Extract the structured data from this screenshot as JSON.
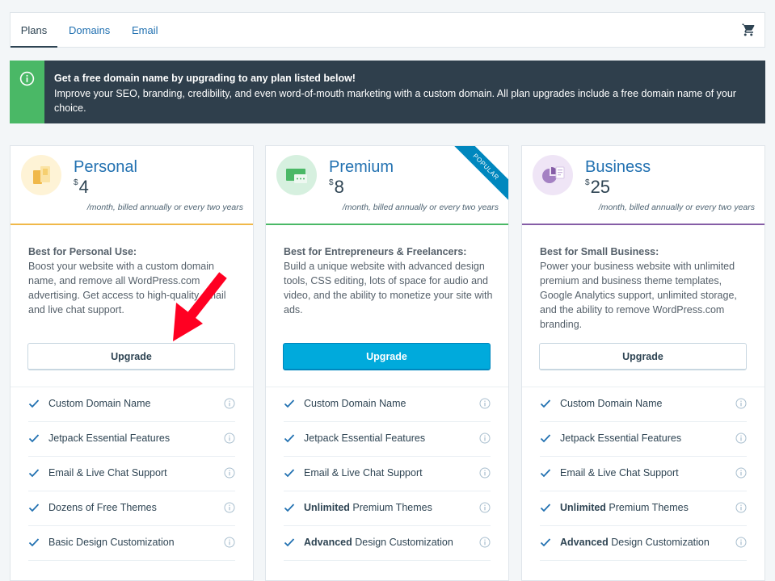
{
  "nav": {
    "tabs": [
      "Plans",
      "Domains",
      "Email"
    ],
    "active_tab": "Plans"
  },
  "banner": {
    "title": "Get a free domain name by upgrading to any plan listed below!",
    "text": "Improve your SEO, branding, credibility, and even word-of-mouth marketing with a custom domain. All plan upgrades include a free domain name of your choice."
  },
  "plans": [
    {
      "name": "Personal",
      "currency": "$",
      "price": "4",
      "billing": "/month, billed annually or every two years",
      "desc_title": "Best for Personal Use:",
      "desc": "Boost your website with a custom domain name, and remove all WordPress.com advertising. Get access to high-quality email and live chat support.",
      "button": "Upgrade",
      "accent": "#f0b849",
      "features": [
        {
          "bold": "",
          "text": "Custom Domain Name"
        },
        {
          "bold": "",
          "text": "Jetpack Essential Features"
        },
        {
          "bold": "",
          "text": "Email & Live Chat Support"
        },
        {
          "bold": "",
          "text": "Dozens of Free Themes"
        },
        {
          "bold": "",
          "text": "Basic Design Customization"
        }
      ]
    },
    {
      "name": "Premium",
      "currency": "$",
      "price": "8",
      "billing": "/month, billed annually or every two years",
      "desc_title": "Best for Entrepreneurs & Freelancers:",
      "desc": "Build a unique website with advanced design tools, CSS editing, lots of space for audio and video, and the ability to monetize your site with ads.",
      "button": "Upgrade",
      "ribbon": "POPULAR",
      "accent": "#4ab866",
      "features": [
        {
          "bold": "",
          "text": "Custom Domain Name"
        },
        {
          "bold": "",
          "text": "Jetpack Essential Features"
        },
        {
          "bold": "",
          "text": "Email & Live Chat Support"
        },
        {
          "bold": "Unlimited",
          "text": " Premium Themes"
        },
        {
          "bold": "Advanced",
          "text": " Design Customization"
        }
      ]
    },
    {
      "name": "Business",
      "currency": "$",
      "price": "25",
      "billing": "/month, billed annually or every two years",
      "desc_title": "Best for Small Business:",
      "desc": "Power your business website with unlimited premium and business theme templates, Google Analytics support, unlimited storage, and the ability to remove WordPress.com branding.",
      "button": "Upgrade",
      "accent": "#855da6",
      "features": [
        {
          "bold": "",
          "text": "Custom Domain Name"
        },
        {
          "bold": "",
          "text": "Jetpack Essential Features"
        },
        {
          "bold": "",
          "text": "Email & Live Chat Support"
        },
        {
          "bold": "Unlimited",
          "text": " Premium Themes"
        },
        {
          "bold": "Advanced",
          "text": " Design Customization"
        }
      ]
    }
  ]
}
